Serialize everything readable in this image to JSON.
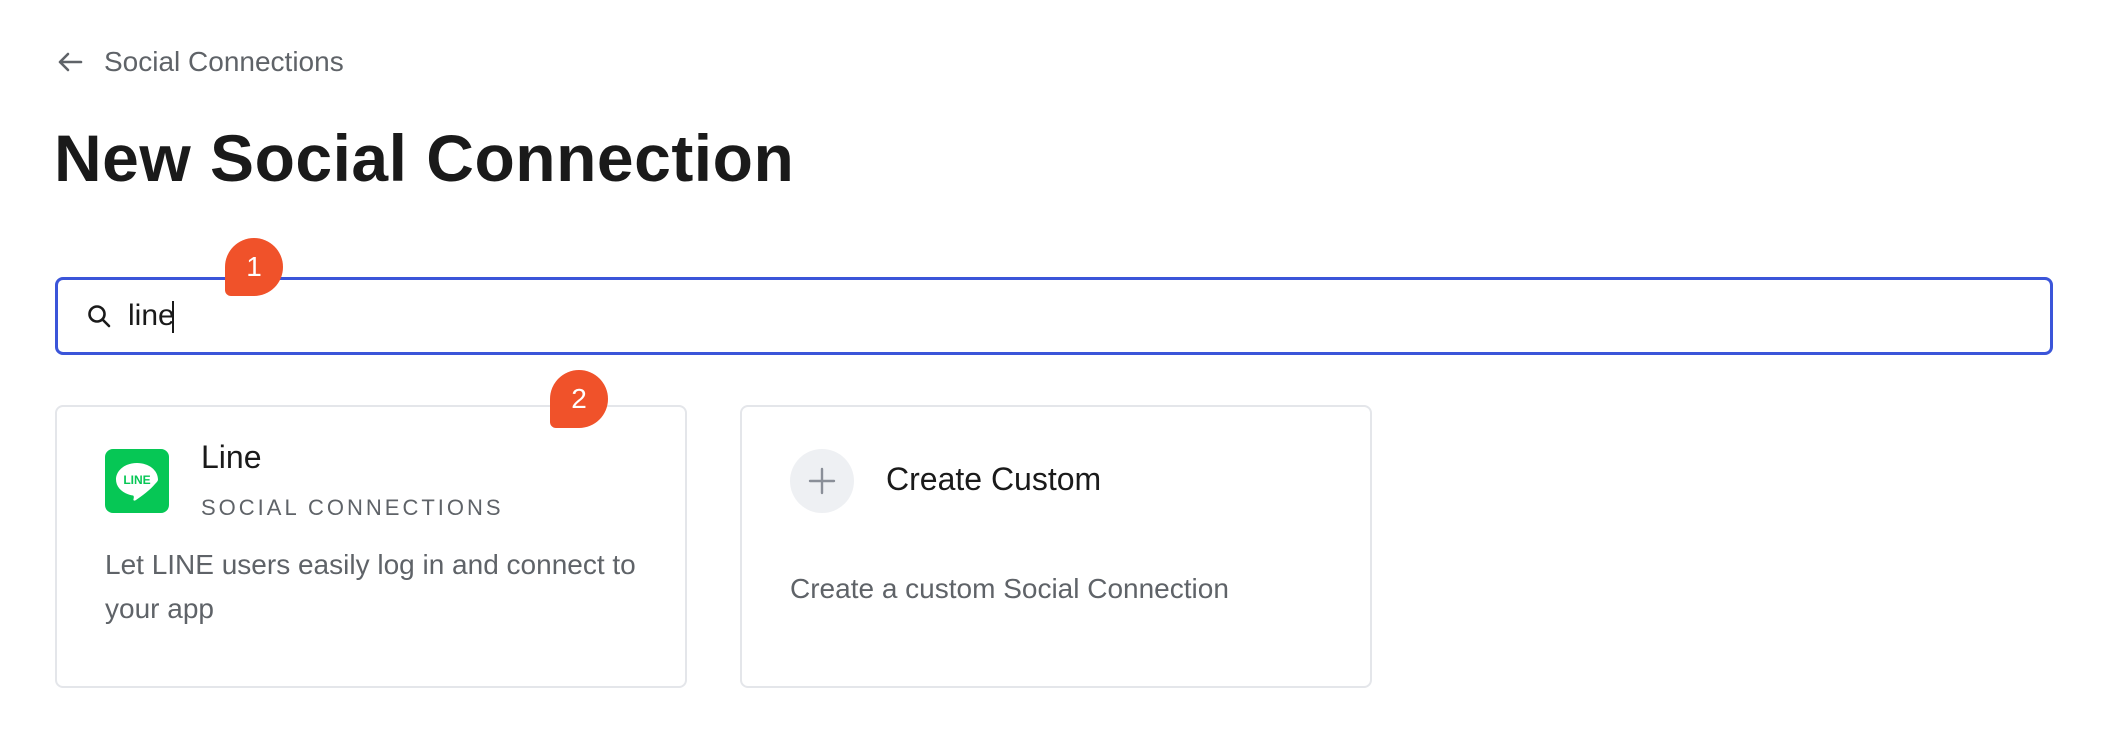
{
  "header": {
    "back_label": "Social Connections",
    "back_icon": "arrow-left-icon",
    "title": "New Social Connection"
  },
  "search": {
    "value": "line",
    "placeholder": "",
    "icon": "search-icon"
  },
  "cards": [
    {
      "title": "Line",
      "subtitle": "SOCIAL CONNECTIONS",
      "description": "Let LINE users easily log in and connect to your app",
      "logo_text": "LINE",
      "logo_color": "#06c755",
      "icon": "line-logo-icon"
    },
    {
      "title": "Create Custom",
      "description": "Create a custom Social Connection",
      "icon": "plus-icon"
    }
  ],
  "markers": [
    {
      "label": "1"
    },
    {
      "label": "2"
    }
  ],
  "colors": {
    "accent": "#3b55d9",
    "marker": "#f0522a",
    "line_green": "#06c755"
  }
}
